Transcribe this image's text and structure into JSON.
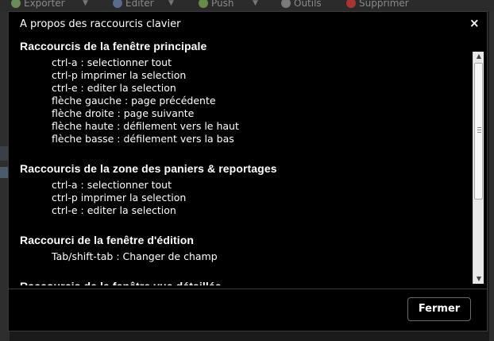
{
  "toolbar": {
    "items": [
      "Exporter",
      "Editer",
      "Push",
      "Outils",
      "Supprimer"
    ]
  },
  "dialog": {
    "title": "A propos des raccourcis clavier",
    "close_icon": "×",
    "sections": [
      {
        "title": "Raccourcis de la fenêtre principale",
        "shortcuts": [
          "ctrl-a : selectionner tout",
          "ctrl-p imprimer la selection",
          "ctrl-e : editer la selection",
          "flèche gauche : page précédente",
          "flèche droite : page suivante",
          "flèche haute : défilement vers le haut",
          "flèche basse : défilement vers la bas"
        ]
      },
      {
        "title": "Raccourcis de la zone des paniers & reportages",
        "shortcuts": [
          "ctrl-a : selectionner tout",
          "ctrl-p imprimer la selection",
          "ctrl-e : editer la selection"
        ]
      },
      {
        "title": "Raccourci de la fenêtre d'édition",
        "shortcuts": [
          "Tab/shift-tab : Changer de champ"
        ]
      },
      {
        "title": "Raccourcis de la fenêtre vue détaillée",
        "shortcuts": []
      }
    ],
    "close_button": "Fermer"
  },
  "colors": {
    "dialog_bg": "#000000",
    "text": "#ffffff",
    "scrollbar_track": "#e9e9e9"
  },
  "icons": [
    "close-icon",
    "scroll-up-arrow-icon",
    "scroll-down-arrow-icon"
  ]
}
